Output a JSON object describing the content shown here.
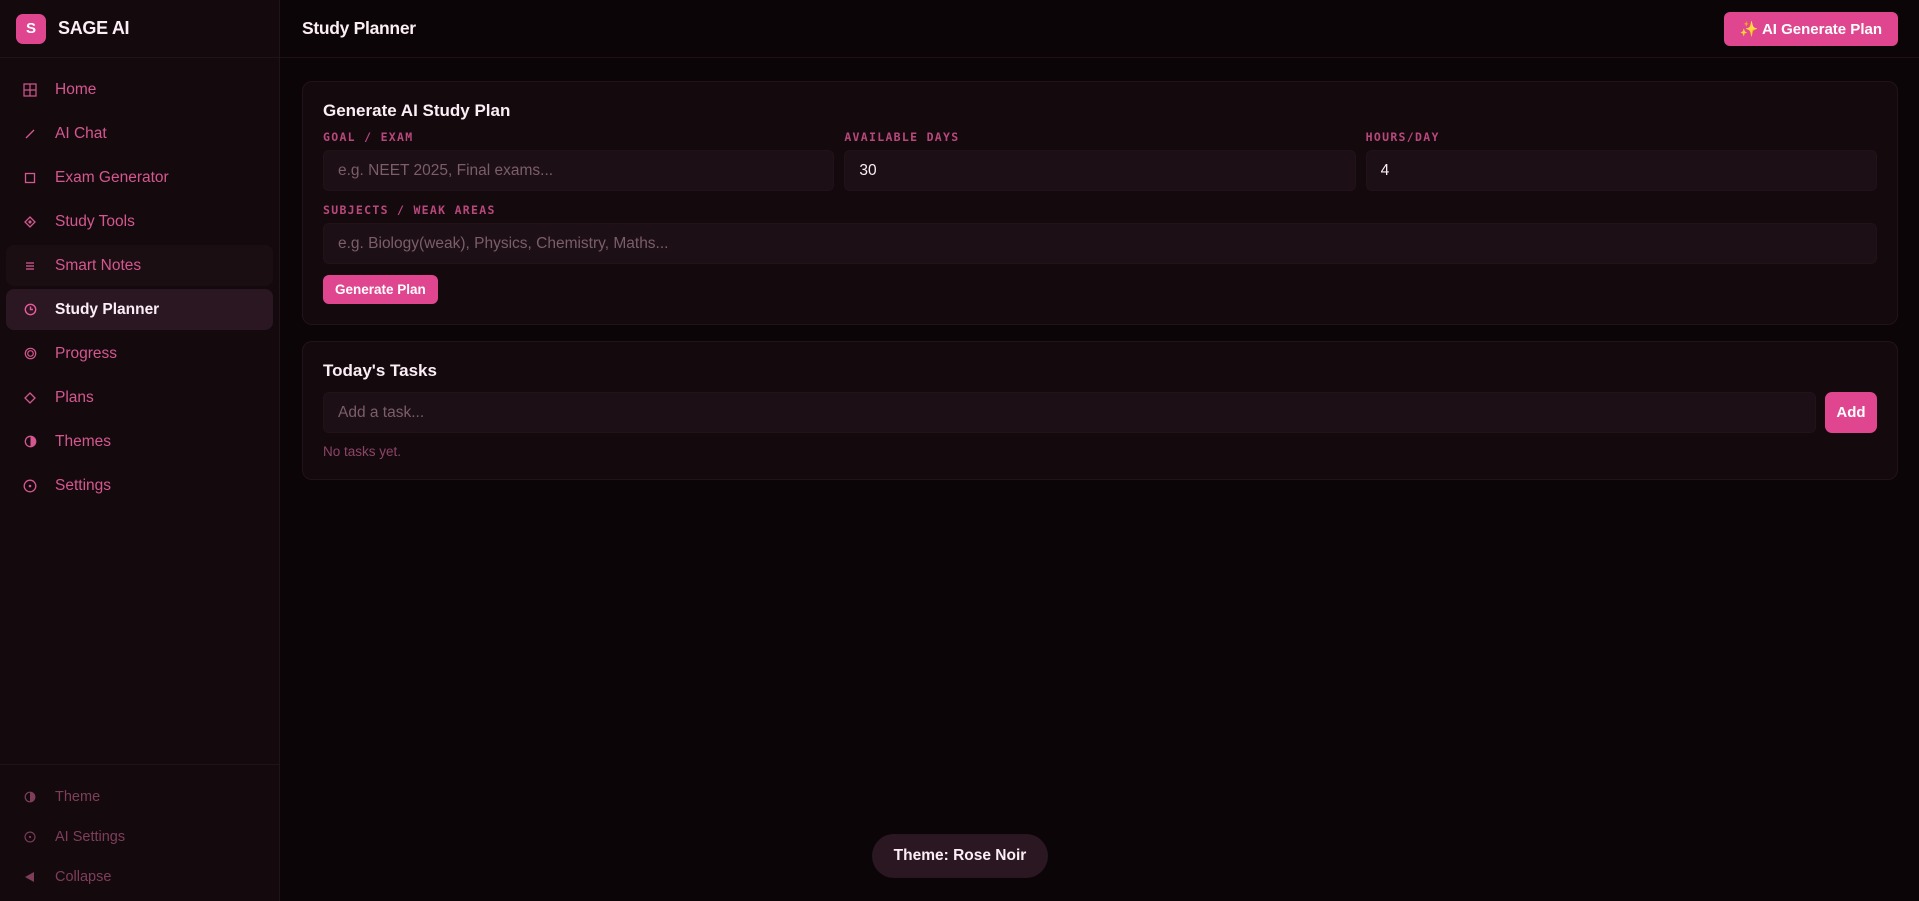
{
  "app": {
    "logo_letter": "S",
    "name": "SAGE AI"
  },
  "sidebar": {
    "items": [
      {
        "label": "Home",
        "icon": "grid-icon"
      },
      {
        "label": "AI Chat",
        "icon": "arrow-icon"
      },
      {
        "label": "Exam Generator",
        "icon": "square-icon"
      },
      {
        "label": "Study Tools",
        "icon": "diamond-icon"
      },
      {
        "label": "Smart Notes",
        "icon": "lines-icon"
      },
      {
        "label": "Study Planner",
        "icon": "clock-icon"
      },
      {
        "label": "Progress",
        "icon": "target-icon"
      },
      {
        "label": "Plans",
        "icon": "diamond-outline-icon"
      },
      {
        "label": "Themes",
        "icon": "contrast-icon"
      },
      {
        "label": "Settings",
        "icon": "circle-dot-icon"
      }
    ],
    "active_index": 5,
    "footer": [
      {
        "label": "Theme",
        "icon": "contrast-icon"
      },
      {
        "label": "AI Settings",
        "icon": "circle-dot-icon"
      },
      {
        "label": "Collapse",
        "icon": "triangle-left-icon"
      }
    ]
  },
  "header": {
    "title": "Study Planner",
    "ai_button": "✨ AI Generate Plan"
  },
  "plan_card": {
    "title": "Generate AI Study Plan",
    "goal_label": "GOAL / EXAM",
    "goal_placeholder": "e.g. NEET 2025, Final exams...",
    "days_label": "AVAILABLE DAYS",
    "days_value": "30",
    "hours_label": "HOURS/DAY",
    "hours_value": "4",
    "subjects_label": "SUBJECTS / WEAK AREAS",
    "subjects_placeholder": "e.g. Biology(weak), Physics, Chemistry, Maths...",
    "generate_button": "Generate Plan"
  },
  "tasks_card": {
    "title": "Today's Tasks",
    "input_placeholder": "Add a task...",
    "add_button": "Add",
    "empty_message": "No tasks yet."
  },
  "toast": {
    "text": "Theme: Rose Noir"
  },
  "colors": {
    "accent": "#e0468f",
    "background": "#0c0507",
    "panel": "#140a0e"
  }
}
